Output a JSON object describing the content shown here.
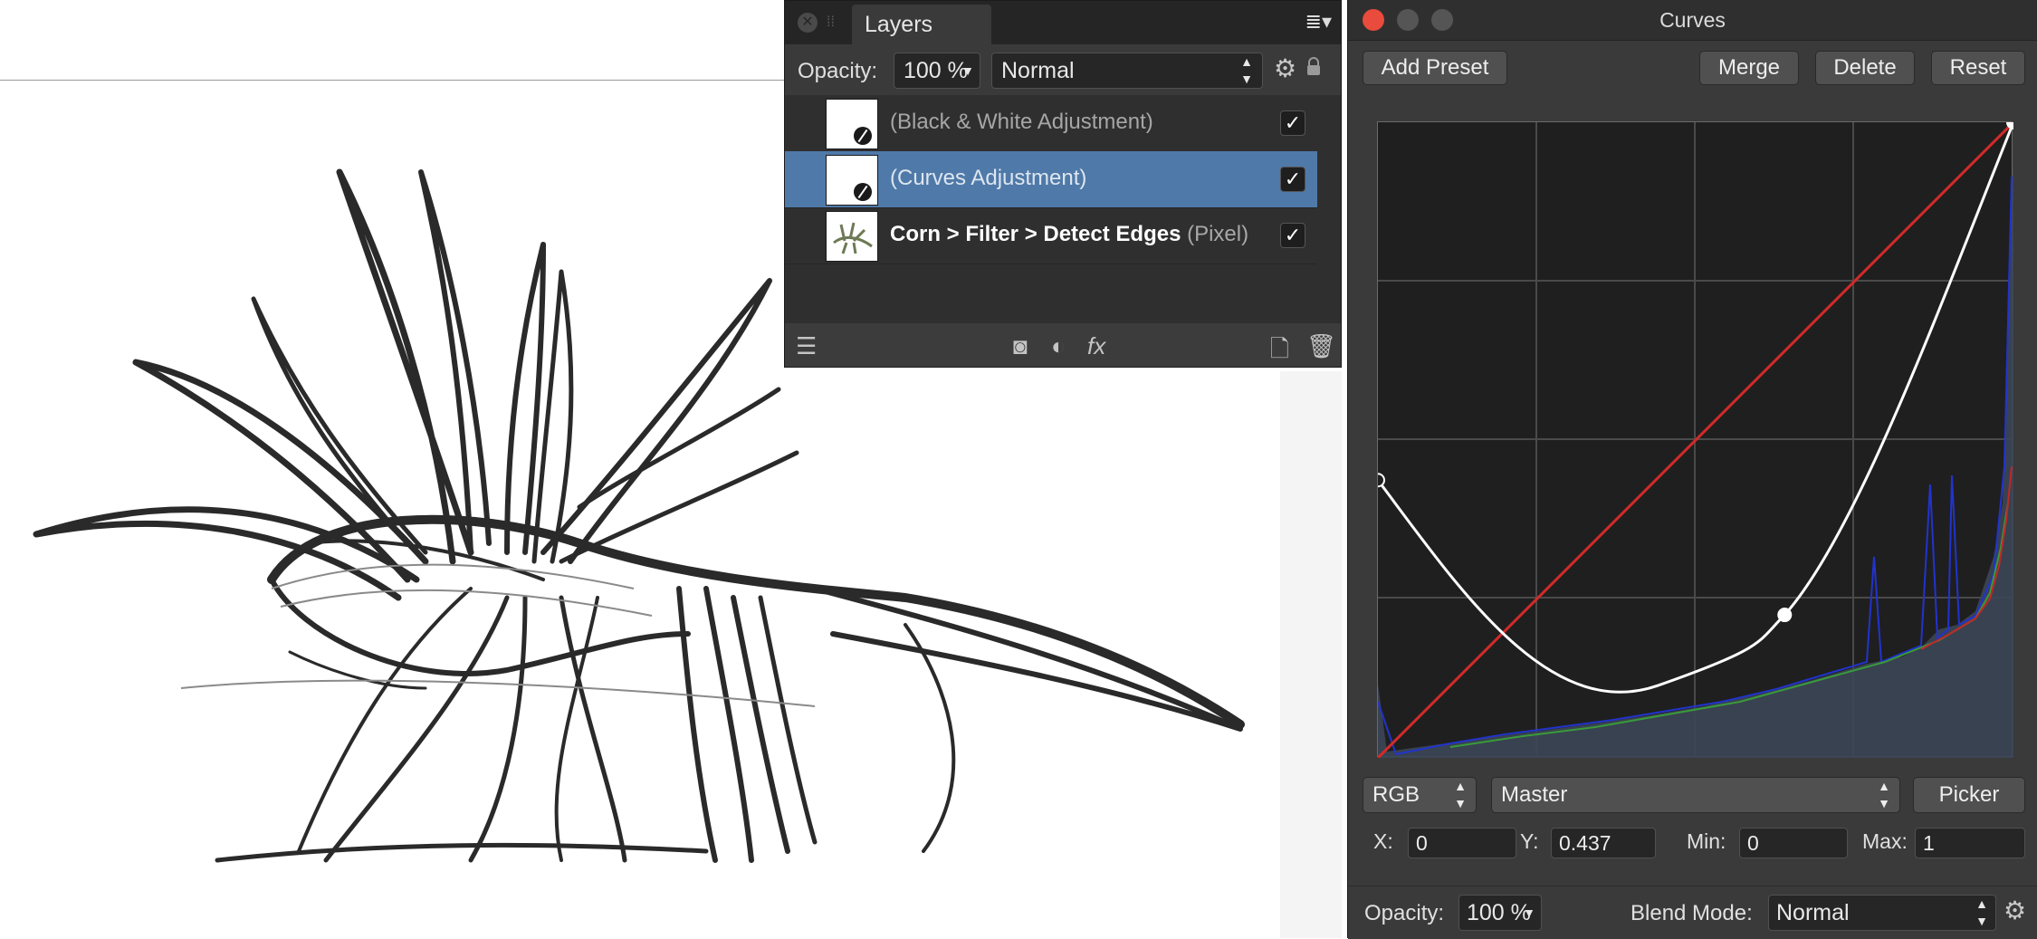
{
  "layers_panel": {
    "tab_label": "Layers",
    "opacity_label": "Opacity:",
    "opacity_value": "100 %",
    "blend_mode": "Normal",
    "layers": [
      {
        "name": "(Black & White Adjustment)",
        "selected": false,
        "checked": true
      },
      {
        "name": "(Curves Adjustment)",
        "selected": true,
        "checked": true
      },
      {
        "name_bold": "Corn > Filter > Detect Edges",
        "name_suffix": " (Pixel)",
        "selected": false,
        "checked": true
      }
    ],
    "check_mark": "✓"
  },
  "curves_panel": {
    "title": "Curves",
    "buttons": {
      "add_preset": "Add Preset",
      "merge": "Merge",
      "delete": "Delete",
      "reset": "Reset"
    },
    "channel": "RGB",
    "curve_mode": "Master",
    "picker": "Picker",
    "x_label": "X:",
    "x_value": "0",
    "y_label": "Y:",
    "y_value": "0.437",
    "min_label": "Min:",
    "min_value": "0",
    "max_label": "Max:",
    "max_value": "1",
    "opacity_label": "Opacity:",
    "opacity_value": "100 %",
    "blend_label": "Blend Mode:",
    "blend_value": "Normal",
    "curve_points": [
      [
        0,
        0.437
      ],
      [
        0.64,
        0.225
      ],
      [
        1,
        1
      ]
    ],
    "colors": {
      "diagonal": "#d42a2a",
      "curve": "#ffffff",
      "close": "#e94b3c"
    }
  }
}
